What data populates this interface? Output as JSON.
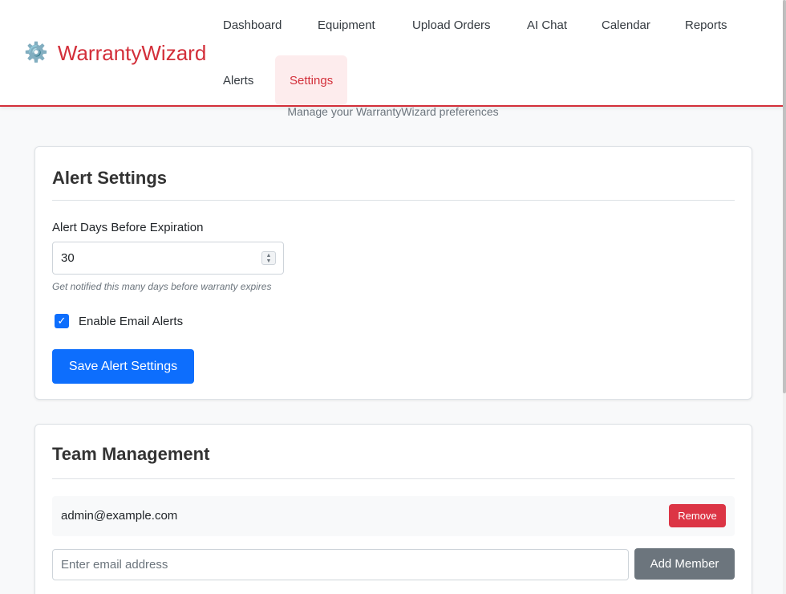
{
  "brand": {
    "icon": "gear-icon",
    "name": "WarrantyWizard",
    "icon_glyph": "⚙️"
  },
  "nav": {
    "items": [
      {
        "label": "Dashboard",
        "active": false
      },
      {
        "label": "Equipment",
        "active": false
      },
      {
        "label": "Upload Orders",
        "active": false
      },
      {
        "label": "AI Chat",
        "active": false
      },
      {
        "label": "Calendar",
        "active": false
      },
      {
        "label": "Reports",
        "active": false
      },
      {
        "label": "Alerts",
        "active": false
      },
      {
        "label": "Settings",
        "active": true
      }
    ]
  },
  "page": {
    "subtitle": "Manage your WarrantyWizard preferences"
  },
  "alert_settings": {
    "title": "Alert Settings",
    "days_label": "Alert Days Before Expiration",
    "days_value": "30",
    "help_text": "Get notified this many days before warranty expires",
    "email_alerts_label": "Enable Email Alerts",
    "email_alerts_checked": true,
    "save_label": "Save Alert Settings"
  },
  "team": {
    "title": "Team Management",
    "members": [
      {
        "email": "admin@example.com",
        "remove_label": "Remove"
      }
    ],
    "email_placeholder": "Enter email address",
    "add_label": "Add Member"
  },
  "colors": {
    "brand": "#d32f3a",
    "primary": "#0d6efd",
    "danger": "#dc3545",
    "secondary": "#6c757d"
  }
}
